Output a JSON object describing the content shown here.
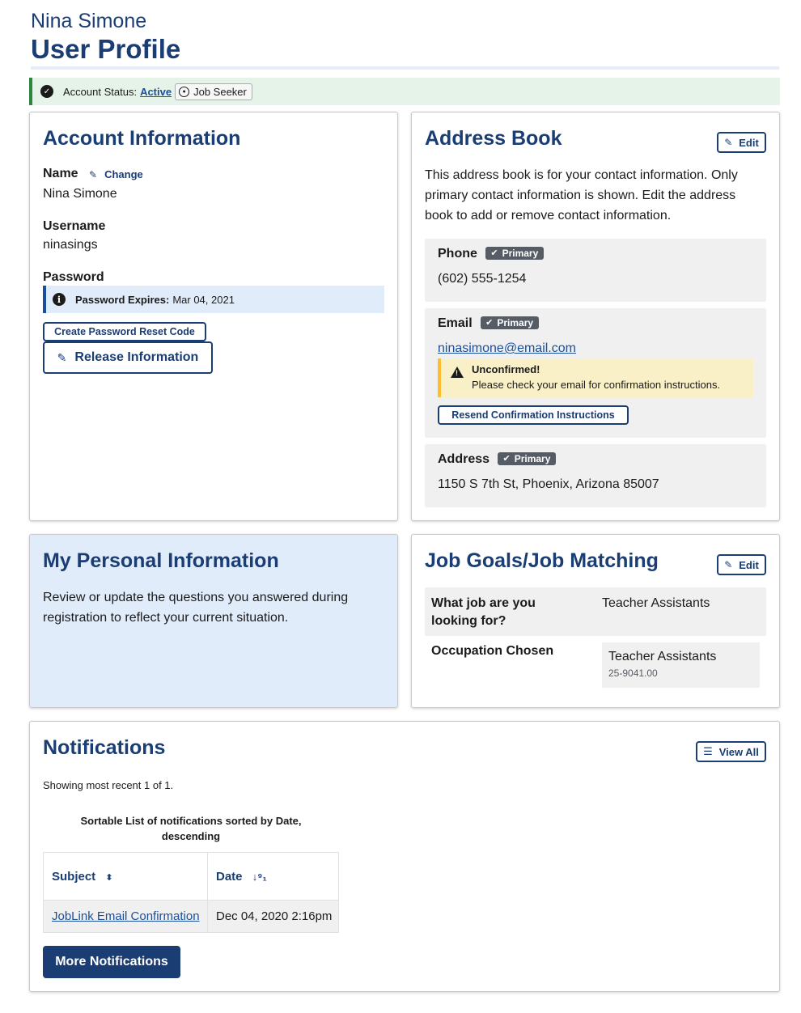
{
  "header": {
    "user_name": "Nina Simone",
    "page_title": "User Profile"
  },
  "status": {
    "label": "Account Status:",
    "value": "Active",
    "role": "Job Seeker"
  },
  "account": {
    "title": "Account Information",
    "name_label": "Name",
    "change_label": "Change",
    "name_value": "Nina Simone",
    "username_label": "Username",
    "username_value": "ninasings",
    "password_label": "Password",
    "password_expires_label": "Password Expires:",
    "password_expires_value": "Mar 04, 2021",
    "reset_code_button": "Create Password Reset Code",
    "release_button": "Release Information"
  },
  "address_book": {
    "title": "Address Book",
    "edit_label": "Edit",
    "description": "This address book is for your contact information. Only primary contact information is shown. Edit the address book to add or remove contact information.",
    "primary_tag": "Primary",
    "phone_label": "Phone",
    "phone_value": "(602) 555-1254",
    "email_label": "Email",
    "email_value": "ninasimone@email.com",
    "unconfirmed_title": "Unconfirmed!",
    "unconfirmed_text": "Please check your email for confirmation instructions.",
    "resend_button": "Resend Confirmation Instructions",
    "address_label": "Address",
    "address_value": "1150 S 7th St, Phoenix, Arizona 85007"
  },
  "personal": {
    "title": "My Personal Information",
    "description": "Review or update the questions you answered during registration to reflect your current situation."
  },
  "job_goals": {
    "title": "Job Goals/Job Matching",
    "edit_label": "Edit",
    "q1_label": "What job are you looking for?",
    "q1_value": "Teacher Assistants",
    "q2_label": "Occupation Chosen",
    "occupation_name": "Teacher Assistants",
    "occupation_code": "25-9041.00"
  },
  "notifications": {
    "title": "Notifications",
    "view_all_label": "View All",
    "showing_text": "Showing most recent 1 of 1.",
    "caption": "Sortable List of notifications sorted by Date, descending",
    "col_subject": "Subject",
    "col_date": "Date",
    "rows": [
      {
        "subject": "JobLink Email Confirmation",
        "date": "Dec 04, 2020 2:16pm"
      }
    ],
    "more_button": "More Notifications"
  },
  "colors": {
    "brand_navy": "#1a3d73",
    "link_blue": "#1a4f9c",
    "success_green": "#2e8540",
    "warning_yellow": "#ffbe2e"
  }
}
